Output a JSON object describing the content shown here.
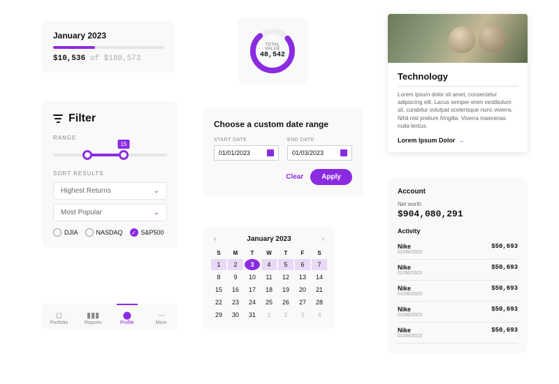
{
  "colors": {
    "accent": "#8a2be2"
  },
  "progress": {
    "title": "January 2023",
    "current": "$10,536",
    "of": " of ",
    "total": "$180,573",
    "percent": 38
  },
  "donut": {
    "label": "TOTAL VALUE",
    "value": "48,542",
    "percent": 75
  },
  "filter": {
    "title": "Filter",
    "range_label": "RANGE",
    "range": {
      "low_pct": 30,
      "high_pct": 62,
      "tooltip": "15"
    },
    "sort_label": "SORT RESULTS",
    "selects": [
      "Highest Returns",
      "Most Popular"
    ],
    "radios": [
      {
        "label": "DJIA",
        "selected": false
      },
      {
        "label": "NASDAQ",
        "selected": false
      },
      {
        "label": "S&P500",
        "selected": true
      }
    ]
  },
  "date_range": {
    "title": "Choose a custom date range",
    "start_label": "START DATE",
    "end_label": "END DATE",
    "start": "01/01/2023",
    "end": "01/03/2023",
    "clear": "Clear",
    "apply": "Apply"
  },
  "calendar": {
    "month": "January 2023",
    "weekdays": [
      "S",
      "M",
      "T",
      "W",
      "T",
      "F",
      "S"
    ],
    "days": [
      {
        "n": 1,
        "range": true
      },
      {
        "n": 2,
        "range": true
      },
      {
        "n": 3,
        "sel": true
      },
      {
        "n": 4,
        "range": true
      },
      {
        "n": 5,
        "range": true
      },
      {
        "n": 6,
        "range": true
      },
      {
        "n": 7,
        "range": true
      },
      {
        "n": 8
      },
      {
        "n": 9
      },
      {
        "n": 10
      },
      {
        "n": 11
      },
      {
        "n": 12
      },
      {
        "n": 13
      },
      {
        "n": 14
      },
      {
        "n": 15
      },
      {
        "n": 16
      },
      {
        "n": 17
      },
      {
        "n": 18
      },
      {
        "n": 19
      },
      {
        "n": 20
      },
      {
        "n": 21
      },
      {
        "n": 22
      },
      {
        "n": 23
      },
      {
        "n": 24
      },
      {
        "n": 25
      },
      {
        "n": 26
      },
      {
        "n": 27
      },
      {
        "n": 28
      },
      {
        "n": 29
      },
      {
        "n": 30
      },
      {
        "n": 31
      },
      {
        "n": 1,
        "muted": true
      },
      {
        "n": 2,
        "muted": true
      },
      {
        "n": 3,
        "muted": true
      },
      {
        "n": 4,
        "muted": true
      }
    ]
  },
  "nav": {
    "items": [
      {
        "label": "Portfolio",
        "icon": "◻"
      },
      {
        "label": "Reports",
        "icon": "▮▮▮"
      },
      {
        "label": "Profile",
        "icon": "⬤",
        "active": true
      },
      {
        "label": "More",
        "icon": "⋯"
      }
    ]
  },
  "tech_card": {
    "title": "Technology",
    "desc": "Lorem ipsum dolor sit amet, consectetur adipiscing elit. Lacus semper enim vestibulum sit, curabitur volutpat scelerisque nunc viverra. Nihil nisl pretium fringilla. Viverra maecenas nulla lentus.",
    "link": "Lorem Ipsum Dolor"
  },
  "account": {
    "heading": "Account",
    "networth_label": "Net worth",
    "networth": "$904,080,291",
    "activity_label": "Activity",
    "rows": [
      {
        "name": "Nike",
        "date": "01/06/2023",
        "amount": "$50,693"
      },
      {
        "name": "Nike",
        "date": "01/06/2023",
        "amount": "$50,693"
      },
      {
        "name": "Nike",
        "date": "01/06/2023",
        "amount": "$50,693"
      },
      {
        "name": "Nike",
        "date": "01/06/2023",
        "amount": "$50,693"
      },
      {
        "name": "Nike",
        "date": "01/06/2023",
        "amount": "$50,693"
      }
    ]
  },
  "chart_data": {
    "type": "pie",
    "title": "TOTAL VALUE",
    "values": [
      75,
      25
    ],
    "center_value": 48542
  }
}
